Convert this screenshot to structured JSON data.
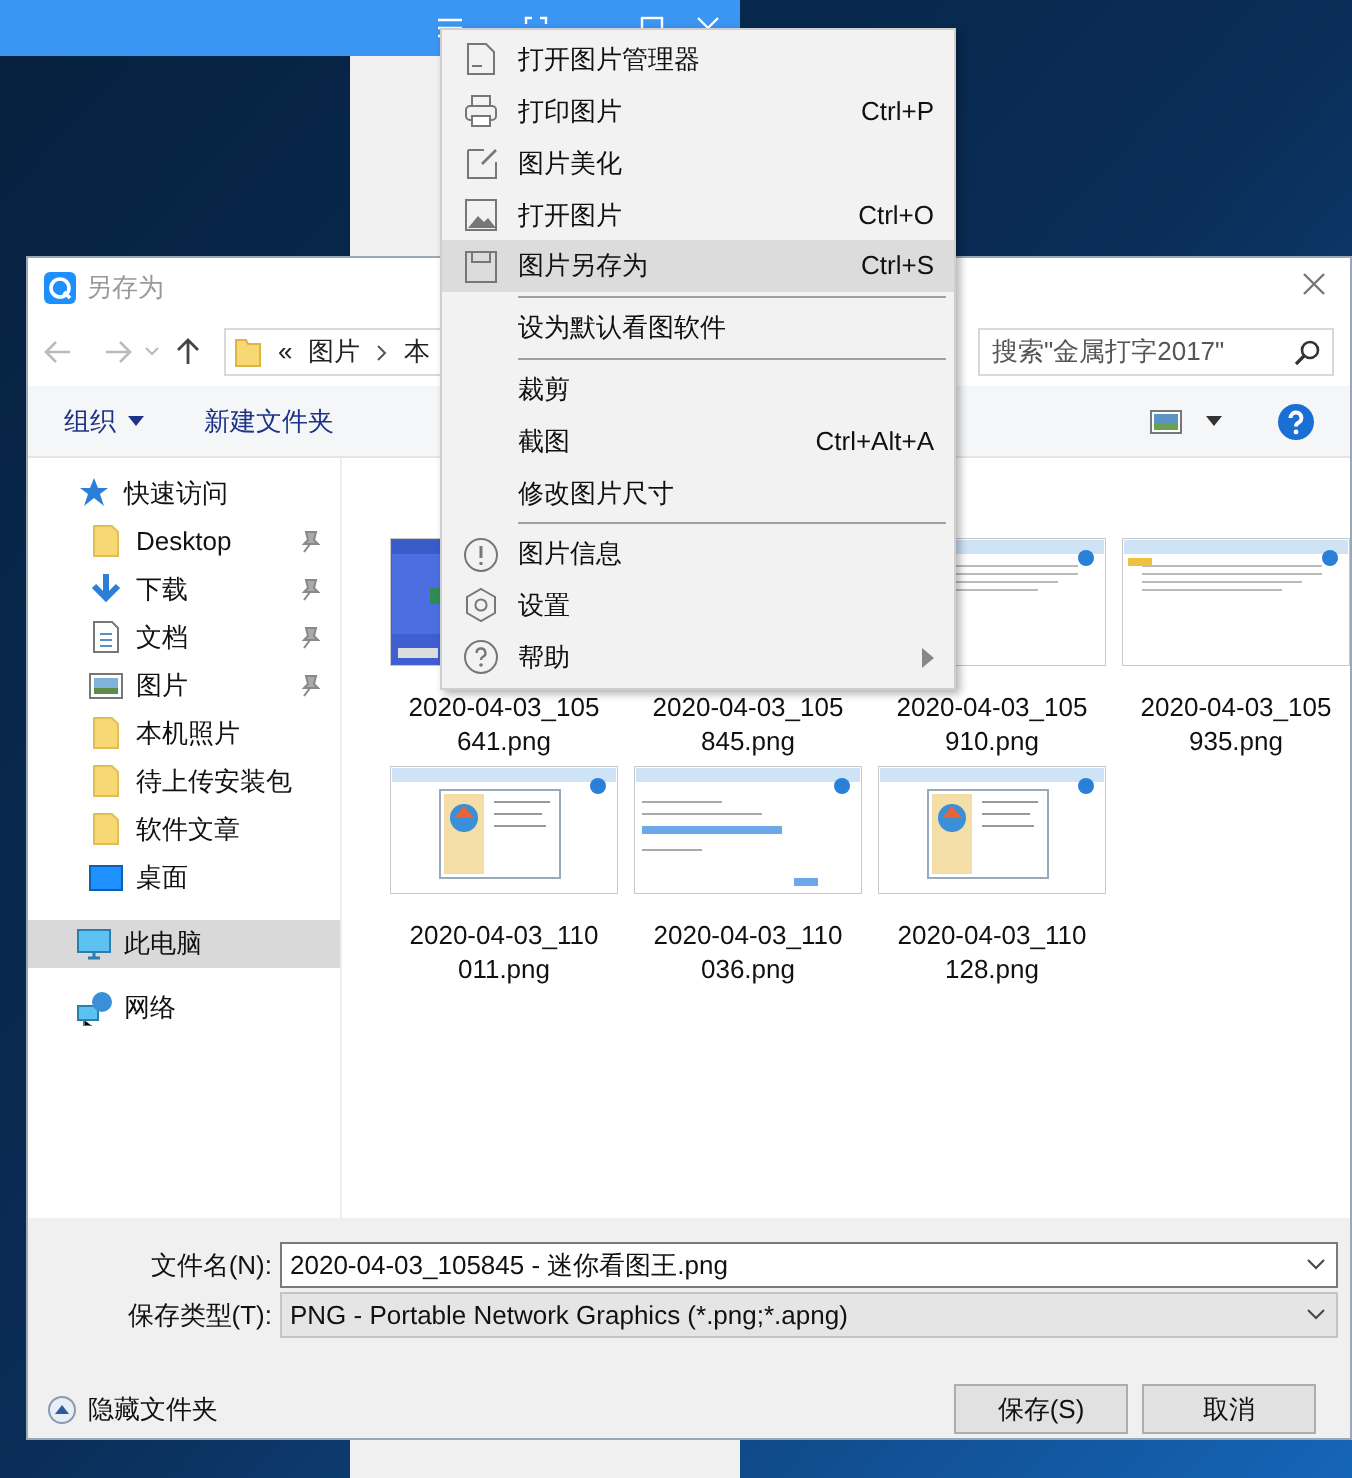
{
  "dialog": {
    "title": "另存为",
    "address": {
      "segments": [
        "«",
        "图片",
        "本"
      ]
    },
    "search": {
      "placeholder": "搜索\"金属打字2017\""
    },
    "toolbar": {
      "organize": "组织",
      "new_folder": "新建文件夹"
    },
    "sidebar": [
      {
        "label": "快速访问",
        "kind": "star",
        "selected": false,
        "children": [
          {
            "label": "Desktop",
            "kind": "folder",
            "pinned": true,
            "selected": false
          },
          {
            "label": "下载",
            "kind": "download",
            "pinned": true,
            "selected": false
          },
          {
            "label": "文档",
            "kind": "document",
            "pinned": true,
            "selected": false
          },
          {
            "label": "图片",
            "kind": "pictures",
            "pinned": true,
            "selected": false
          },
          {
            "label": "本机照片",
            "kind": "folder",
            "pinned": false,
            "selected": false
          },
          {
            "label": "待上传安装包",
            "kind": "folder",
            "pinned": false,
            "selected": false
          },
          {
            "label": "软件文章",
            "kind": "folder",
            "pinned": false,
            "selected": false
          },
          {
            "label": "桌面",
            "kind": "desktop",
            "pinned": false,
            "selected": false
          }
        ]
      },
      {
        "label": "此电脑",
        "kind": "computer",
        "selected": true
      },
      {
        "label": "网络",
        "kind": "network",
        "selected": false
      }
    ],
    "files": [
      {
        "label": "2020-04-03_105\n641.png"
      },
      {
        "label": "2020-04-03_105\n845.png"
      },
      {
        "label": "2020-04-03_105\n910.png"
      },
      {
        "label": "2020-04-03_105\n935.png"
      },
      {
        "label": "2020-04-03_110\n011.png"
      },
      {
        "label": "2020-04-03_110\n036.png"
      },
      {
        "label": "2020-04-03_110\n128.png"
      }
    ],
    "file_name": {
      "label": "文件名(N):",
      "value": "2020-04-03_105845 - 迷你看图王.png"
    },
    "save_type": {
      "label": "保存类型(T):",
      "value": "PNG - Portable Network Graphics (*.png;*.apng)"
    },
    "hide_folders": "隐藏文件夹",
    "buttons": [
      "保存(S)",
      "取消"
    ]
  },
  "context_menu": [
    {
      "label": "打开图片管理器",
      "selected": false
    },
    {
      "label": "打印图片",
      "shortcut": "Ctrl+P",
      "selected": false
    },
    {
      "label": "图片美化",
      "selected": false
    },
    {
      "label": "打开图片",
      "shortcut": "Ctrl+O",
      "selected": false
    },
    {
      "label": "图片另存为",
      "shortcut": "Ctrl+S",
      "selected": true,
      "separator_after": true
    },
    {
      "label": "设为默认看图软件",
      "selected": false,
      "separator_after": true
    },
    {
      "label": "裁剪",
      "selected": false
    },
    {
      "label": "截图",
      "shortcut": "Ctrl+Alt+A",
      "selected": false
    },
    {
      "label": "修改图片尺寸",
      "selected": false,
      "separator_after": true
    },
    {
      "label": "图片信息",
      "selected": false
    },
    {
      "label": "设置",
      "selected": false
    },
    {
      "label": "帮助",
      "selected": false,
      "submenu": true
    }
  ]
}
